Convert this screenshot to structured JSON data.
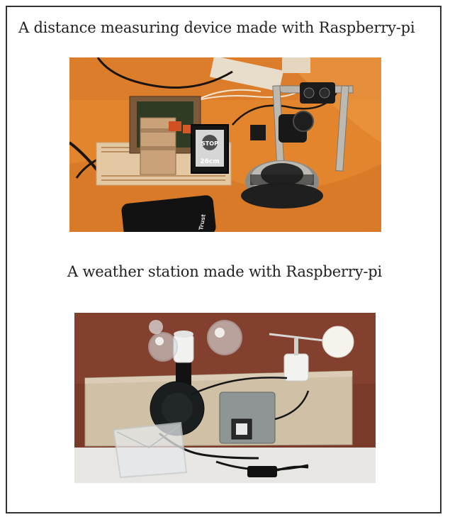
{
  "document": {
    "caption_distance": "A distance measuring device made with Raspberry-pi",
    "caption_weather": "A weather station made with Raspberry-pi"
  },
  "photos": {
    "distance_device": {
      "lcd_label": "STOP",
      "lcd_reading": "26cm",
      "power_bank_brand": "Trust"
    },
    "weather_station": {}
  }
}
